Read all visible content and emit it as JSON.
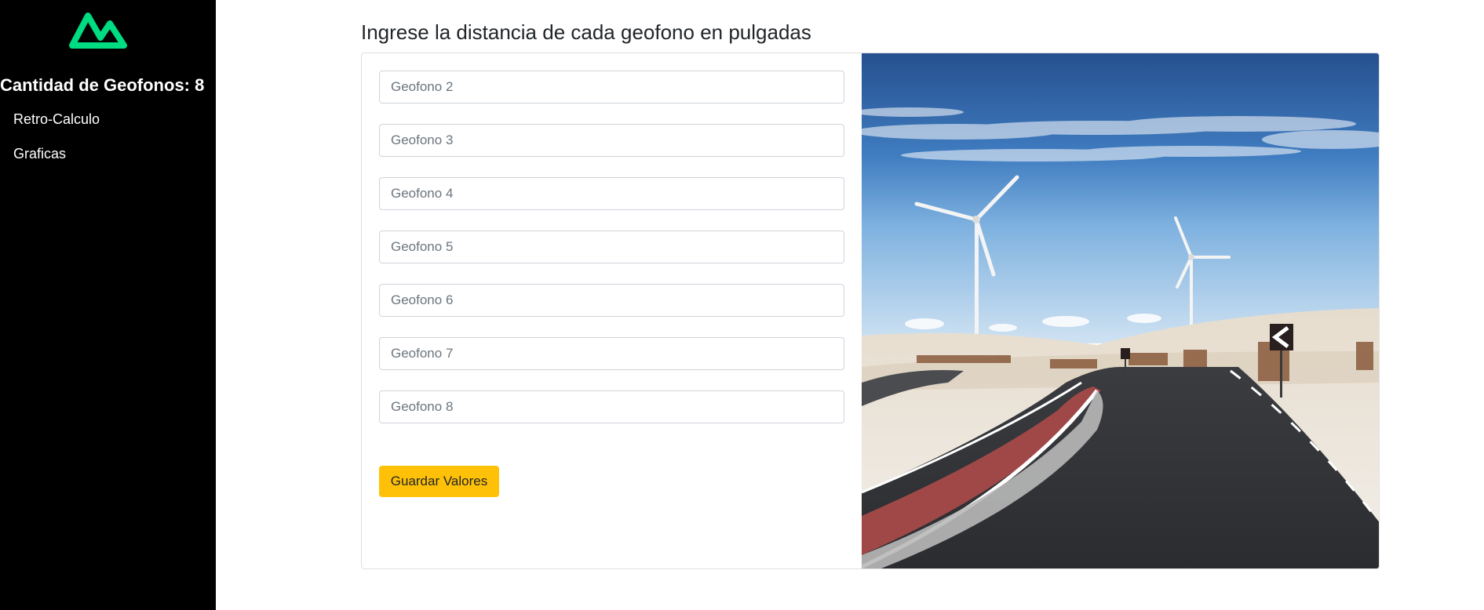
{
  "sidebar": {
    "title": "Cantidad de Geofonos: 8",
    "logo_icon": "mountain-logo-icon",
    "logo_color": "#00dc82",
    "items": [
      {
        "label": "Retro-Calculo"
      },
      {
        "label": "Graficas"
      }
    ]
  },
  "main": {
    "title": "Ingrese la distancia de cada geofono en pulgadas",
    "fields": [
      {
        "placeholder": "Geofono 2",
        "value": ""
      },
      {
        "placeholder": "Geofono 3",
        "value": ""
      },
      {
        "placeholder": "Geofono 4",
        "value": ""
      },
      {
        "placeholder": "Geofono 5",
        "value": ""
      },
      {
        "placeholder": "Geofono 6",
        "value": ""
      },
      {
        "placeholder": "Geofono 7",
        "value": ""
      },
      {
        "placeholder": "Geofono 8",
        "value": ""
      }
    ],
    "save_label": "Guardar Valores",
    "save_color": "#ffc107",
    "image": "wind-turbines-road-photo"
  }
}
